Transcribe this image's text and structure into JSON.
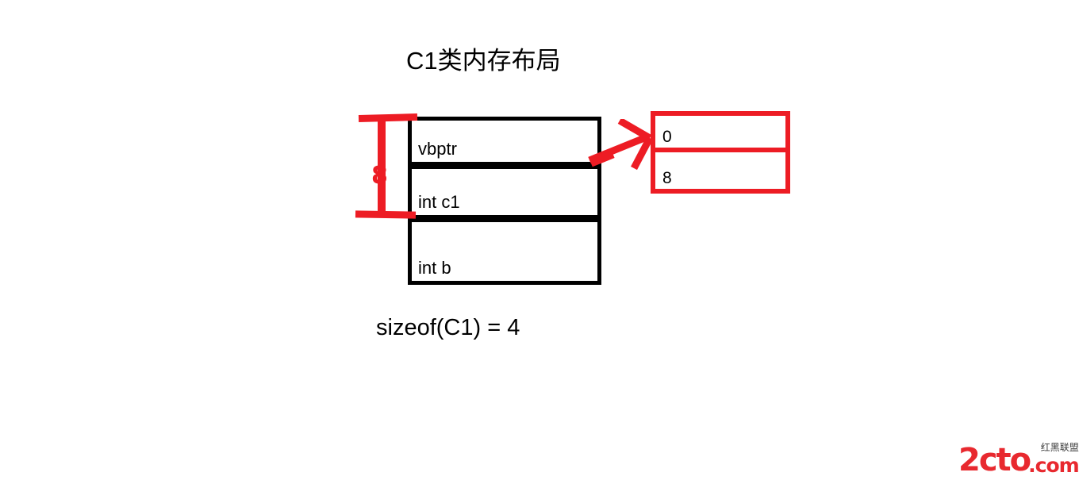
{
  "diagram": {
    "title": "C1类内存布局",
    "caption": "sizeof(C1) = 4",
    "accent_color": "#ED1C24",
    "outline_color": "#000000",
    "background_color": "#FFFFFF",
    "object_layout": {
      "name": "C1 object memory layout",
      "slots": [
        {
          "label": "vbptr"
        },
        {
          "label": "int c1"
        },
        {
          "label": "int b"
        }
      ]
    },
    "size_brace": {
      "value": "8",
      "spans_slots": [
        "vbptr",
        "int c1"
      ]
    },
    "vbtable": {
      "name": "virtual base table",
      "entries": [
        {
          "value": "0"
        },
        {
          "value": "8"
        }
      ]
    },
    "arrow": {
      "name": "vbptr-to-vbtable-arrow",
      "from": "vbptr",
      "to": "vbtable"
    }
  },
  "watermark": {
    "main": "2cto",
    "suffix": ".com",
    "chinese": "红黑联盟"
  }
}
